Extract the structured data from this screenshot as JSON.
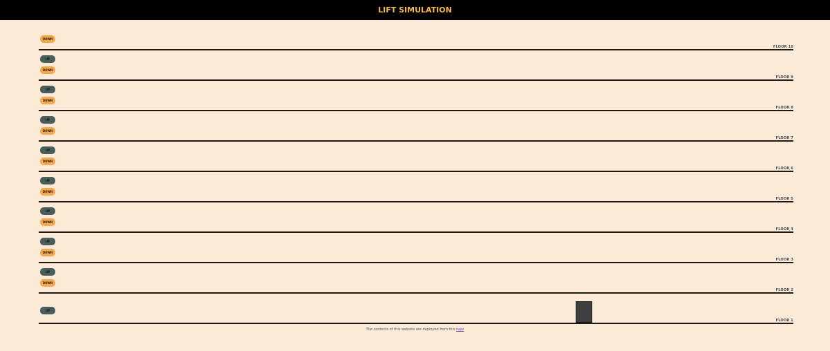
{
  "header": {
    "title": "LIFT SIMULATION"
  },
  "floors": [
    {
      "label": "FLOOR 10",
      "up": null,
      "down": "DOWN"
    },
    {
      "label": "FLOOR 9",
      "up": "UP",
      "down": "DOWN"
    },
    {
      "label": "FLOOR 8",
      "up": "UP",
      "down": "DOWN"
    },
    {
      "label": "FLOOR 7",
      "up": "UP",
      "down": "DOWN"
    },
    {
      "label": "FLOOR 6",
      "up": "UP",
      "down": "DOWN"
    },
    {
      "label": "FLOOR 5",
      "up": "UP",
      "down": "DOWN"
    },
    {
      "label": "FLOOR 4",
      "up": "UP",
      "down": "DOWN"
    },
    {
      "label": "FLOOR 3",
      "up": "UP",
      "down": "DOWN"
    },
    {
      "label": "FLOOR 2",
      "up": "UP",
      "down": "DOWN"
    },
    {
      "label": "FLOOR 1",
      "up": "UP",
      "down": null
    }
  ],
  "lift": {
    "current_floor": 1
  },
  "footer": {
    "text": "The contents of this website are deployed from this",
    "link_text": "repo"
  },
  "colors": {
    "background": "#fbead6",
    "header_bg": "#000000",
    "header_text": "#f5b942",
    "up_button": "#4a5e5d",
    "down_button": "#f5a84a",
    "lift": "#404040"
  }
}
